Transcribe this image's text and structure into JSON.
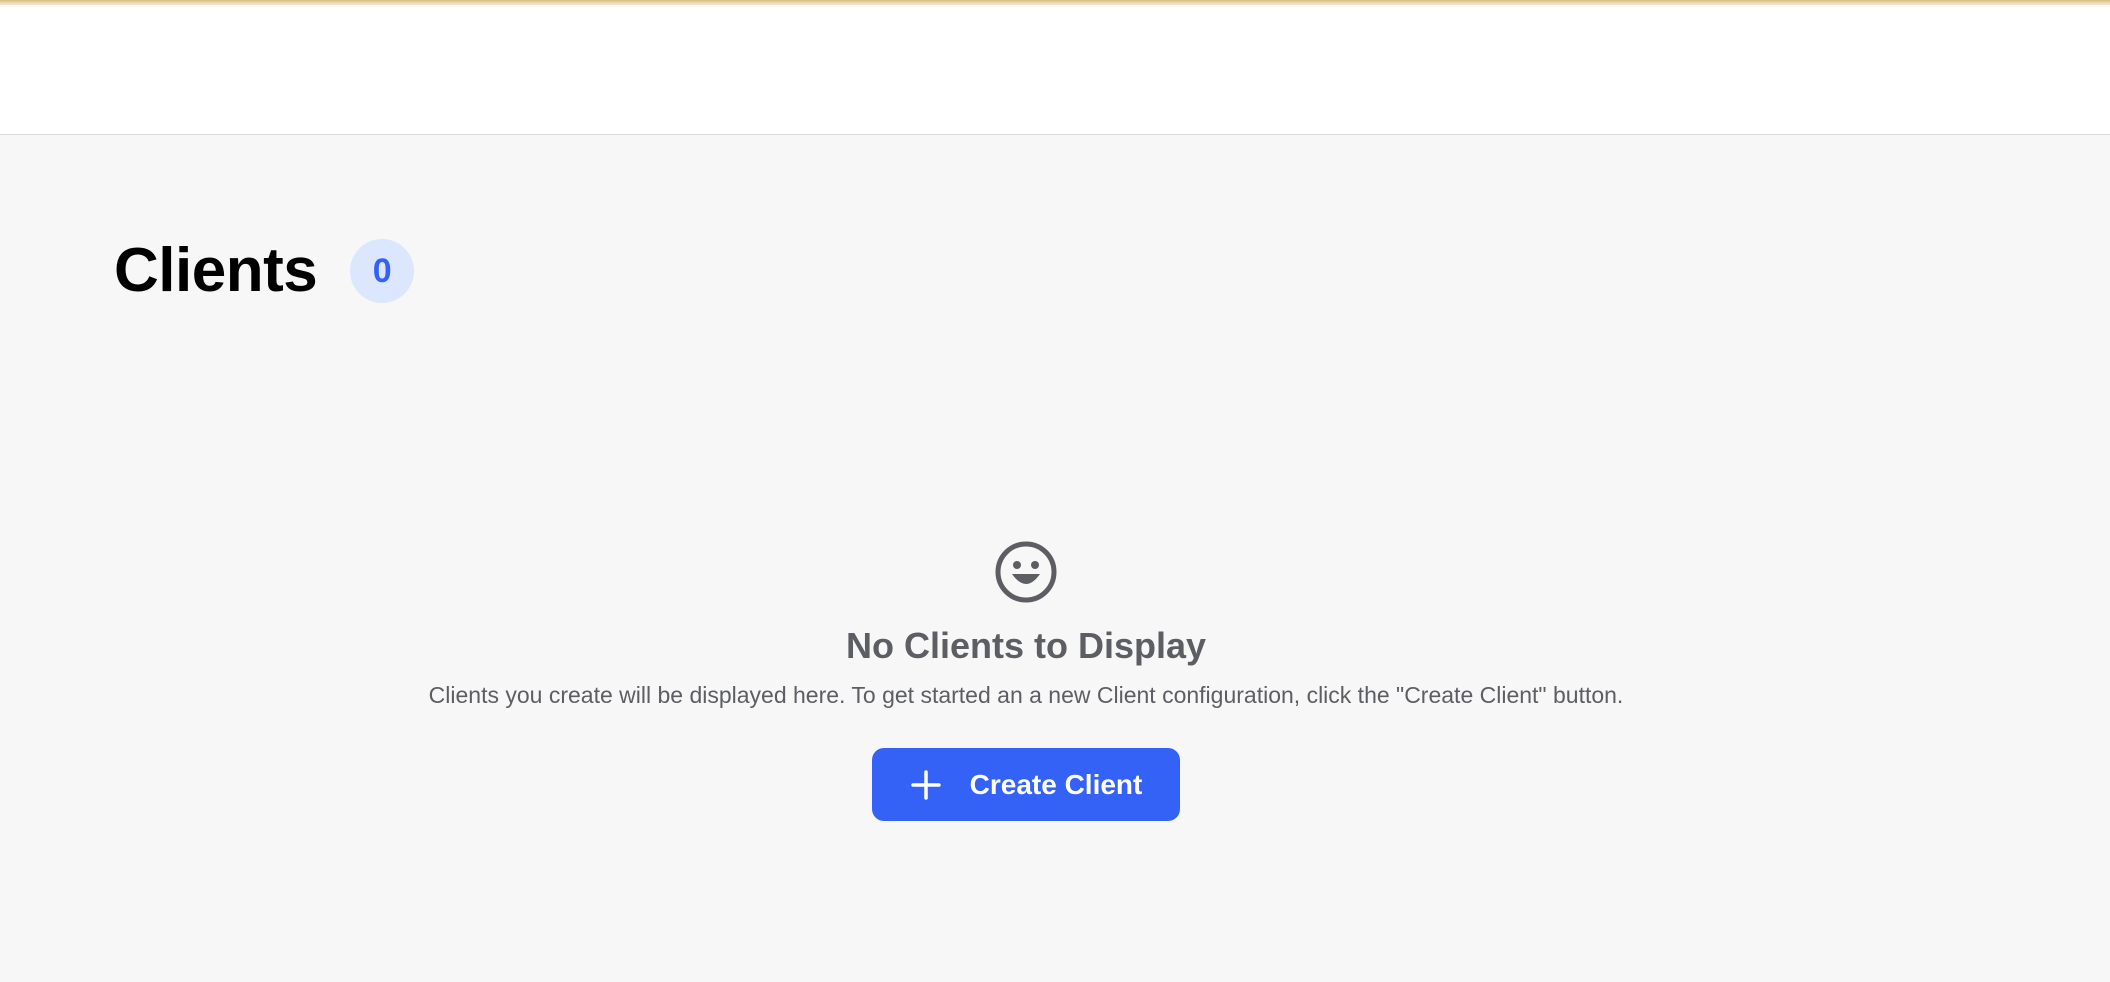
{
  "page": {
    "title": "Clients",
    "count": "0"
  },
  "empty_state": {
    "icon": "smiley-icon",
    "title": "No Clients to Display",
    "description": "Clients you create will be displayed here. To get started an a new Client configuration, click the \"Create Client\" button.",
    "button_label": "Create Client",
    "button_icon": "plus-icon"
  },
  "colors": {
    "accent": "#3461f6",
    "badge_bg": "#dce6fd",
    "muted_text": "#5d5e63",
    "background": "#f7f7f7"
  }
}
